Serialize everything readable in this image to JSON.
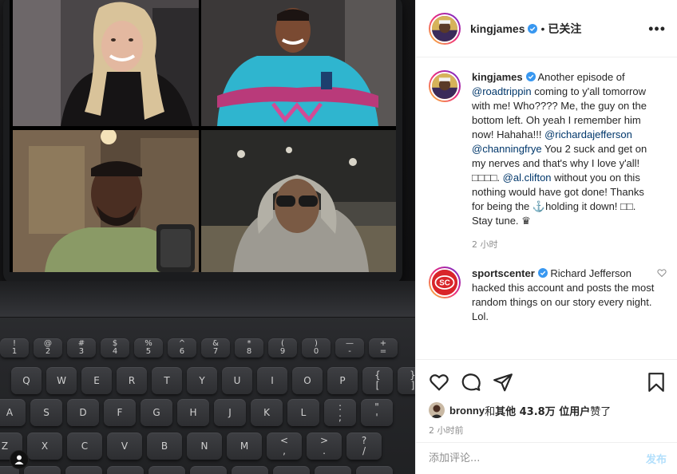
{
  "colors": {
    "link": "#00376b",
    "verified": "#3897f0",
    "muted": "#8e8e8e",
    "post_button_disabled": "#b2dffc"
  },
  "keyboard": {
    "row0": [
      "!\n1",
      "@\n2",
      "#\n3",
      "$\n4",
      "%\n5",
      "^\n6",
      "&\n7",
      "*\n8",
      "(\n9",
      ")\n0",
      "—\n-",
      "+\n="
    ],
    "row1": [
      "Q",
      "W",
      "E",
      "R",
      "T",
      "Y",
      "U",
      "I",
      "O",
      "P",
      "{\n[",
      "}\n]"
    ],
    "row2": [
      "A",
      "S",
      "D",
      "F",
      "G",
      "H",
      "J",
      "K",
      "L",
      ":\n;",
      "\"\n'"
    ],
    "row3": [
      "Z",
      "X",
      "C",
      "V",
      "B",
      "N",
      "M",
      "<\n,",
      ">\n.",
      "?\n/"
    ],
    "row4": [
      "",
      "",
      "",
      "",
      "",
      "",
      "",
      "",
      "",
      ""
    ]
  },
  "header": {
    "username": "kingjames",
    "dot": "•",
    "follow_status": "已关注",
    "more_icon": "more-horizontal-icon"
  },
  "caption": {
    "username": "kingjames",
    "text_1": "Another episode of ",
    "mention_roadtrippin": "@roadtrippin",
    "text_2": " coming to y'all tomorrow with me! Who???? Me, the guy on the bottom left. Oh yeah I remember him now! Hahaha!!! ",
    "mention_richard": "@richardajefferson",
    "mention_channing": "@channingfrye",
    "text_3": " You 2 suck and get on my nerves and that's why I love y'all! □□□□. ",
    "mention_al": "@al.clifton",
    "text_4": " without you on this nothing would have got done! Thanks for being the ⚓holding it down! □□. Stay tune. ",
    "crown_glyph": "♛",
    "time": "2 小时"
  },
  "comment": {
    "username": "sportscenter",
    "text": "Richard Jefferson hacked this account and posts the most random things on our story every night. Lol.",
    "logo_text": "SC"
  },
  "likes": {
    "first_user": "bronny",
    "and": " 和 ",
    "others_label": "其他 43.8万 位用户",
    "suffix": " 赞了"
  },
  "post_time": "2 小时前",
  "add_comment": {
    "placeholder": "添加评论...",
    "post_label": "发布"
  }
}
